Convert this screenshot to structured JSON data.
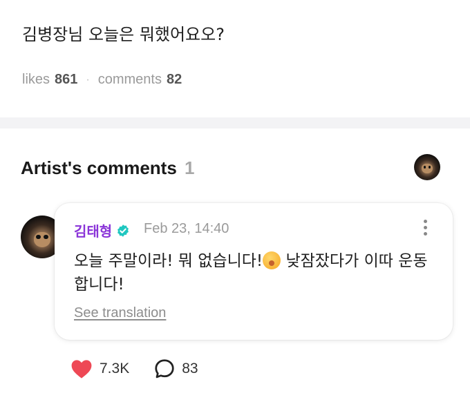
{
  "post": {
    "text": "김병장님 오늘은 뭐했어요오?",
    "likes_label": "likes",
    "likes_count": "861",
    "separator": "·",
    "comments_label": "comments",
    "comments_count": "82"
  },
  "artist_comments": {
    "title": "Artist's comments",
    "count": "1"
  },
  "comment": {
    "author": "김태형",
    "verified_icon": "verified-check-icon",
    "timestamp": "Feb 23, 14:40",
    "text_before_emoji": "오늘 주말이라! 뭐 없습니다!",
    "emoji_icon": "yawning-face-icon",
    "text_after_emoji": " 낮잠잤다가 이따 운동합니다!",
    "see_translation": "See translation",
    "like_count": "7.3K",
    "reply_count": "83"
  },
  "colors": {
    "author": "#8a34d8",
    "verified": "#20c7c0",
    "heart": "#ee4855",
    "muted": "#9a9a9a"
  }
}
